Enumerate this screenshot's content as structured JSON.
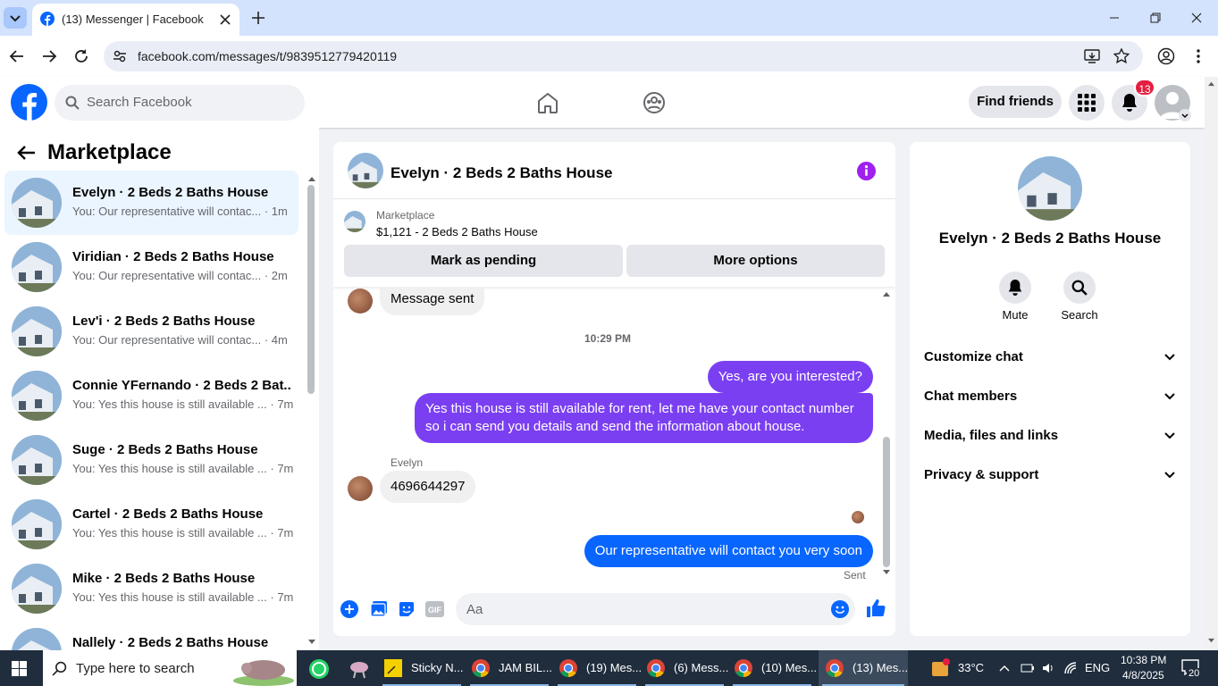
{
  "browser": {
    "tab_title": "(13) Messenger | Facebook",
    "url": "facebook.com/messages/t/9839512779420119"
  },
  "header": {
    "search_placeholder": "Search Facebook",
    "find_friends": "Find friends",
    "notifications_count": "13"
  },
  "sidebar": {
    "title": "Marketplace",
    "conversations": [
      {
        "name": "Evelyn · 2 Beds 2 Baths House",
        "preview": "You: Our representative will contac... · 1m"
      },
      {
        "name": "Viridian · 2 Beds 2 Baths House",
        "preview": "You: Our representative will contac... · 2m"
      },
      {
        "name": "Lev'i · 2 Beds 2 Baths House",
        "preview": "You: Our representative will contac... · 4m"
      },
      {
        "name": "Connie YFernando · 2 Beds 2 Bat...",
        "preview": "You: Yes this house is still available ... · 7m"
      },
      {
        "name": "Suge · 2 Beds 2 Baths House",
        "preview": "You: Yes this house is still available ... · 7m"
      },
      {
        "name": "Cartel · 2 Beds 2 Baths House",
        "preview": "You: Yes this house is still available ... · 7m"
      },
      {
        "name": "Mike · 2 Beds 2 Baths House",
        "preview": "You: Yes this house is still available ... · 7m"
      },
      {
        "name": "Nallely · 2 Beds 2 Baths House",
        "preview": ""
      }
    ]
  },
  "chat": {
    "title": "Evelyn · 2 Beds 2 Baths House",
    "listing_source": "Marketplace",
    "listing": "$1,121 - 2 Beds 2 Baths House",
    "mark_pending": "Mark as pending",
    "more_options": "More options",
    "messages": {
      "sent_notice": "Message sent",
      "timestamp": "10:29 PM",
      "out1": "Yes, are you interested?",
      "out2": "Yes this house is still available for rent, let me have your contact number so i can send you details and send the information about house.",
      "sender": "Evelyn",
      "in1": "4696644297",
      "out3": "Our representative will contact you very soon",
      "status": "Sent"
    },
    "composer_placeholder": "Aa"
  },
  "details": {
    "name": "Evelyn · 2 Beds 2 Baths House",
    "mute": "Mute",
    "search": "Search",
    "sections": [
      "Customize chat",
      "Chat members",
      "Media, files and links",
      "Privacy & support"
    ]
  },
  "taskbar": {
    "search_placeholder": "Type here to search",
    "apps": [
      "Sticky N...",
      "JAM BIL...",
      "(19) Mes...",
      "(6) Mess...",
      "(10) Mes...",
      "(13) Mes..."
    ],
    "weather": "33°C",
    "language": "ENG",
    "time": "10:38 PM",
    "date": "4/8/2025",
    "notifications": "20"
  },
  "colors": {
    "fb_blue": "#0866ff",
    "purple_bubble": "#7b3ff2",
    "info_icon": "#a020f0",
    "badge_red": "#e41e3f"
  }
}
